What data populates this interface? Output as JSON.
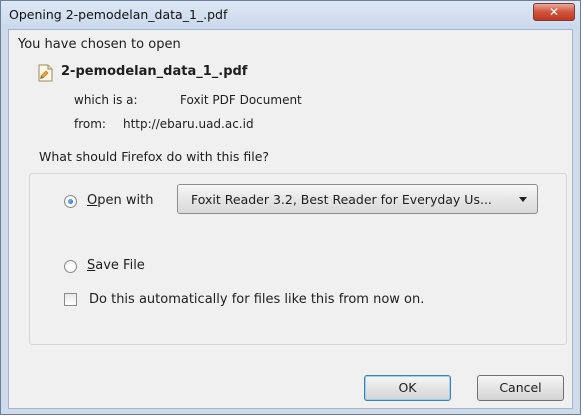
{
  "window": {
    "title": "Opening 2-pemodelan_data_1_.pdf",
    "close_glyph": "✕"
  },
  "dialog": {
    "heading": "You have chosen to open",
    "filename": "2-pemodelan_data_1_.pdf",
    "file_icon": "pdf-file-icon",
    "which_is_label": "which is a:",
    "which_is_value": "Foxit PDF Document",
    "from_label": "from:",
    "from_value": "http://ebaru.uad.ac.id",
    "group_label": "What should Firefox do with this file?",
    "open_with_label": "Open with",
    "open_with_selected": "Foxit Reader 3.2, Best Reader for Everyday Us...",
    "save_file_label": "Save File",
    "auto_checkbox_label": "Do this automatically for files like this from now on.",
    "open_with_checked": true,
    "save_file_checked": false,
    "auto_checked": false
  },
  "buttons": {
    "ok": "OK",
    "cancel": "Cancel"
  },
  "colors": {
    "frame": "#cfdbea",
    "client": "#f0f0f0",
    "close": "#c0381f"
  }
}
